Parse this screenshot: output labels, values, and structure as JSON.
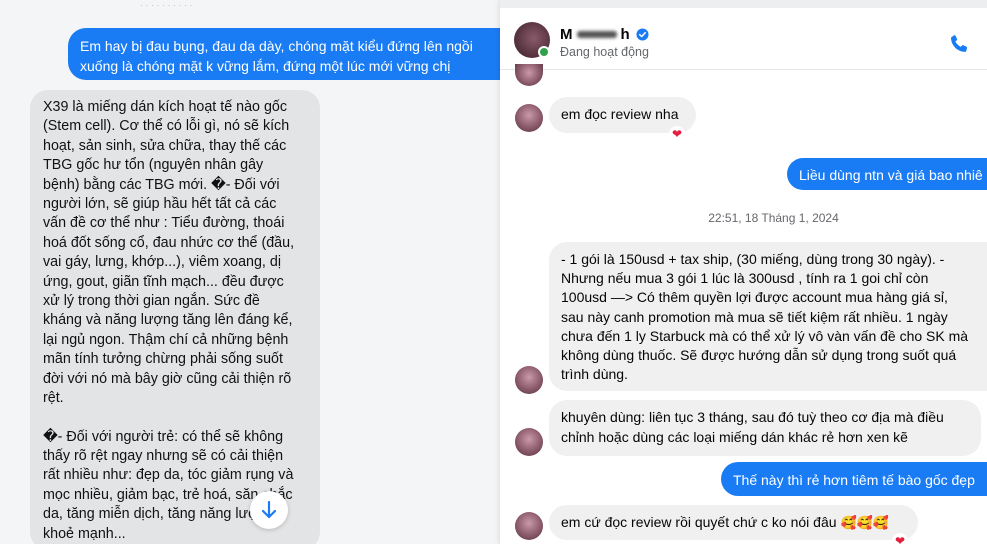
{
  "left": {
    "top_sliver_text": "· · · · · · · · · ·",
    "outgoing_message_lines": [
      "Em hay bị đau bụng, đau dạ dày, chóng mặt kiểu đứng lên ngồi",
      "xuống là chóng mặt k vững lắm, đứng một lúc mới vững chị"
    ],
    "incoming_paragraph_1": [
      "X39 là miếng dán kích hoạt tế nào gốc",
      "(Stem cell). Cơ thể có lỗi gì, nó sẽ kích",
      "hoạt, sản sinh, sửa chữa, thay thế các",
      "TBG gốc hư tổn (nguyên nhân gây",
      "bệnh) bằng các TBG mới. �- Đối với",
      "người lớn, sẽ giúp hầu hết tất cả các",
      "vấn đề cơ thể  như : Tiểu đường, thoái",
      "hoá đốt sống cổ, đau nhức cơ thể (đầu,",
      "vai gáy, lưng, khớp...), viêm xoang, dị",
      "ứng, gout, giãn tĩnh mạch... đều được",
      "xử lý trong thời gian ngắn. Sức đề",
      "kháng và năng lượng tăng lên đáng kể,",
      "lại ngủ ngon.  Thậm chí cả những bệnh",
      "mãn tính tưởng chừng phải sống suốt",
      "đời với nó mà bây giờ cũng cải thiện rõ",
      "rệt."
    ],
    "incoming_paragraph_2": [
      "�- Đối với người trẻ: có thể sẽ không",
      "thấy rõ rệt ngay nhưng sẽ có cải thiện",
      "rất nhiều như: đẹp da, tóc giảm rụng và",
      "mọc nhiều, giảm bạc, trẻ hoá, săn chắc",
      "da, tăng miễn dịch, tăng năng lượng,",
      "khoẻ mạnh..."
    ],
    "scroll_icon": "arrow-down-icon"
  },
  "right": {
    "contact": {
      "name_start": "M",
      "name_end": "h",
      "status": "Đang hoạt động",
      "verified_icon": "verified-badge-icon",
      "call_icon": "phone-icon"
    },
    "messages": {
      "incoming_1": "em đọc review nha",
      "outgoing_1": "Liều dùng ntn và giá bao nhiê",
      "timestamp": "22:51, 18 Tháng 1, 2024",
      "incoming_2_lines": [
        "- 1 gói là 150usd + tax ship, (30 miếng, dùng trong 30 ngày).  -",
        "Nhưng nếu mua 3 gói 1 lúc là 300usd , tính ra 1 goi chỉ còn",
        "100usd —> Có thêm quyền lợi được account mua hàng giá sỉ,",
        "sau này canh promotion mà mua sẽ tiết kiệm rất nhiều.  1 ngày",
        "chưa đến 1 ly Starbuck mà có thể xử lý vô vàn vấn đề cho SK mà",
        "không dùng thuốc. Sẽ được hướng dẫn sử dụng trong suốt quá",
        "trình dùng."
      ],
      "incoming_3_lines": [
        "khuyên dùng: liên tục 3 tháng, sau đó tuỳ theo cơ địa mà điều",
        "chỉnh hoặc dùng các loại miếng dán khác rẻ hơn xen kẽ"
      ],
      "outgoing_2": "Thế này thì rẻ hơn tiêm tế bào gốc đẹp",
      "incoming_4": "em cứ đọc review rồi quyết chứ c ko nói đâu",
      "incoming_4_emojis": "🥰🥰🥰",
      "reaction": "❤"
    }
  },
  "colors": {
    "messenger_blue": "#1a7cf5",
    "incoming_gray": "#f0f0f0",
    "left_incoming_gray": "#e3e4e6",
    "online_green": "#31a24c",
    "reaction_red": "#e41e3f"
  }
}
